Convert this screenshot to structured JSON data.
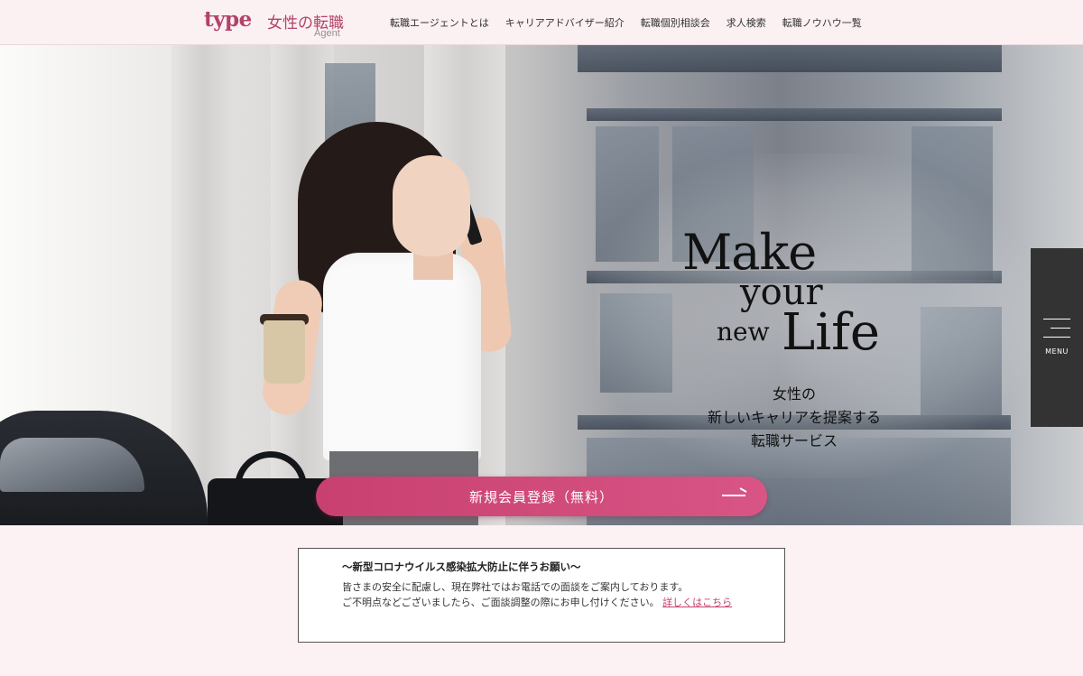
{
  "header": {
    "logo": {
      "type_text": "type",
      "jp_text": "女性の転職",
      "sub_text": "Agent"
    },
    "nav": [
      {
        "label": "転職エージェントとは"
      },
      {
        "label": "キャリアアドバイザー紹介"
      },
      {
        "label": "転職個別相談会"
      },
      {
        "label": "求人検索"
      },
      {
        "label": "転職ノウハウ一覧"
      }
    ]
  },
  "hero": {
    "tagline": {
      "line1": "Make",
      "line2": "your",
      "line3a": "new",
      "line3b": "Life"
    },
    "subcopy": [
      "女性の",
      "新しいキャリアを提案する",
      "転職サービス"
    ],
    "cta_label": "新規会員登録（無料）"
  },
  "side_menu": {
    "label": "MENU",
    "icon": "hamburger-icon"
  },
  "notice": {
    "title": "〜新型コロナウイルス感染拡大防止に伴うお願い〜",
    "line1": "皆さまの安全に配慮し、現在弊社ではお電話での面談をご案内しております。",
    "line2": "ご不明点などございましたら、ご面談調整の際にお申し付けください。",
    "link_label": "詳しくはこちら"
  },
  "colors": {
    "brand": "#b2436a",
    "cta": "#c8406f",
    "header_bg": "#fbf0f2",
    "notice_bg": "#fcf1f3",
    "menu_bg": "#333333"
  }
}
